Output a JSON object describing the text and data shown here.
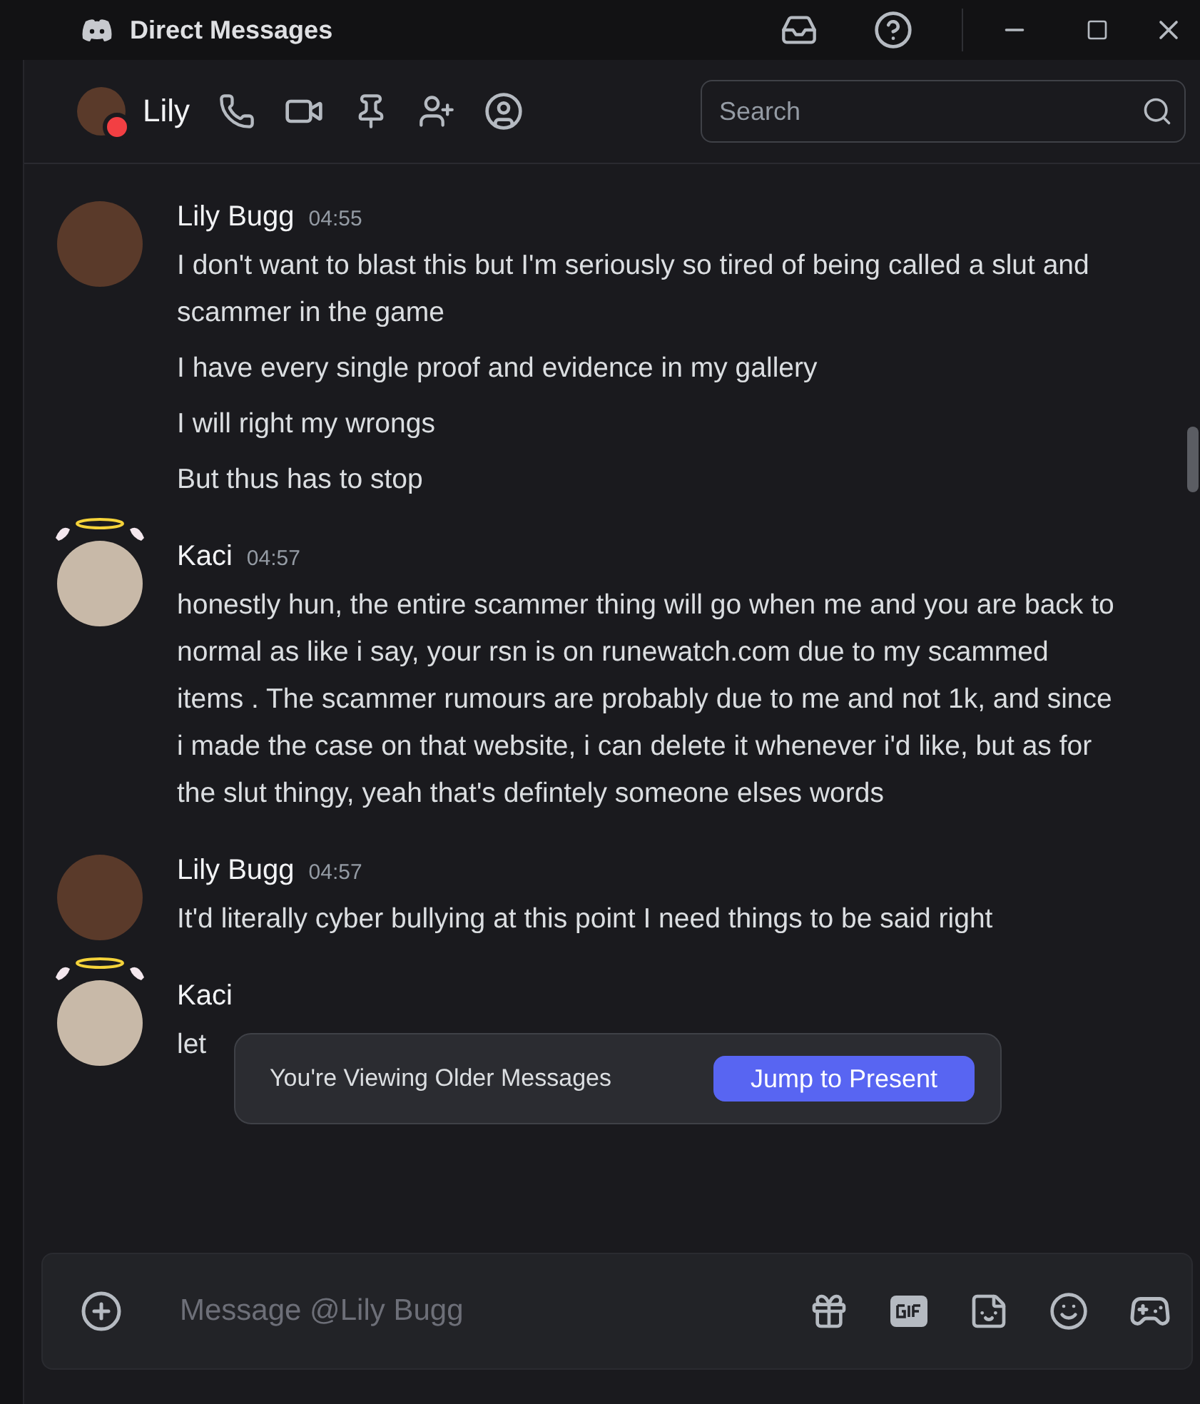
{
  "window": {
    "title": "Direct Messages"
  },
  "header": {
    "name": "Lily",
    "do_not_disturb": true,
    "search": {
      "placeholder": "Search"
    }
  },
  "messages": [
    {
      "author": "Lily Bugg",
      "time": "04:55",
      "decoration": false,
      "lines": [
        "I don't want to blast this but I'm seriously so tired of being called a slut and scammer in the game",
        "I have every single proof and evidence in my gallery",
        "I will right my wrongs",
        "But thus has to stop"
      ]
    },
    {
      "author": "Kaci",
      "time": "04:57",
      "decoration": true,
      "lines": [
        "honestly hun, the entire scammer thing will go when me and you are back to normal as like i say, your rsn is on runewatch.com due to my scammed items . The scammer rumours are probably due to me and not 1k, and since i made the case on that website, i can delete it whenever i'd like, but  as for the slut thingy, yeah that's defintely someone elses words"
      ]
    },
    {
      "author": "Lily Bugg",
      "time": "04:57",
      "decoration": false,
      "lines": [
        "It'd literally cyber bullying at this point I need things to be said right"
      ]
    },
    {
      "author": "Kaci",
      "decoration": true,
      "lines": [
        "let"
      ]
    }
  ],
  "older_banner": {
    "text": "You're Viewing Older Messages",
    "button": "Jump to Present"
  },
  "composer": {
    "placeholder": "Message @Lily Bugg"
  }
}
